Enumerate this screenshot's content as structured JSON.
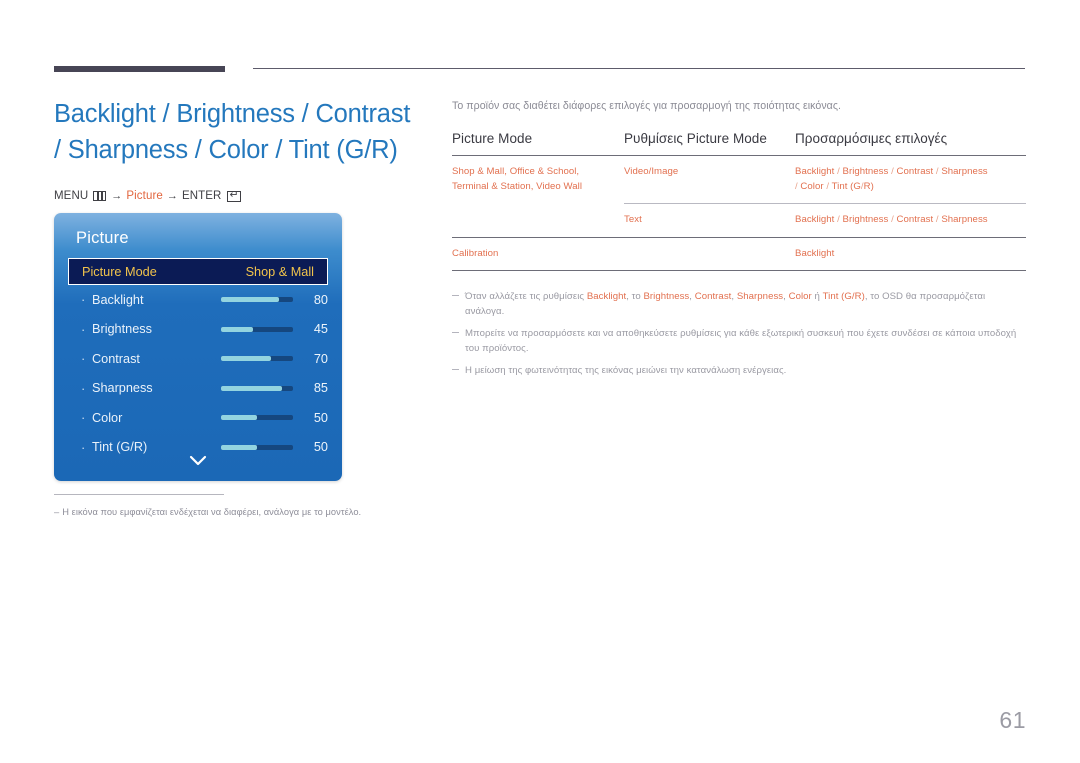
{
  "page": {
    "number": "61",
    "title": "Backlight / Brightness / Contrast\n/ Sharpness / Color / Tint (G/R)"
  },
  "menu_path": {
    "menu_label": "MENU",
    "menu_icon": "menu-grid-icon",
    "arrow1": "→",
    "target": "Picture",
    "arrow2": "→",
    "enter_label": "ENTER",
    "enter_icon": "enter-key-icon"
  },
  "osd": {
    "title": "Picture",
    "highlighted": {
      "label": "Picture Mode",
      "value": "Shop & Mall"
    },
    "items": [
      {
        "label": "Backlight",
        "value": "80",
        "percent": 80
      },
      {
        "label": "Brightness",
        "value": "45",
        "percent": 45
      },
      {
        "label": "Contrast",
        "value": "70",
        "percent": 70
      },
      {
        "label": "Sharpness",
        "value": "85",
        "percent": 85
      },
      {
        "label": "Color",
        "value": "50",
        "percent": 50
      },
      {
        "label": "Tint (G/R)",
        "value": "50",
        "percent": 50
      }
    ],
    "scroll_icon": "chevron-down-icon"
  },
  "left_note": "Η εικόνα που εμφανίζεται ενδέχεται να διαφέρει, ανάλογα με το μοντέλο.",
  "left_note_dash": "–",
  "intro": "Το προϊόν σας διαθέτει διάφορες επιλογές για προσαρμογή της ποιότητας εικόνας.",
  "table": {
    "headers": [
      "Picture Mode",
      "Ρυθμίσεις Picture Mode",
      "Προσαρμόσιμες επιλογές"
    ],
    "rows": [
      {
        "mode": "Shop & Mall, Office & School,\nTerminal & Station, Video Wall",
        "setting": "Video/Image",
        "options": "Backlight / Brightness / Contrast / Sharpness\n/ Color / Tint (G/R)"
      },
      {
        "mode": "",
        "setting": "Text",
        "options": "Backlight / Brightness / Contrast / Sharpness"
      },
      {
        "mode": "Calibration",
        "setting": "",
        "options": "Backlight"
      }
    ]
  },
  "notes": [
    {
      "parts": [
        {
          "t": "Όταν αλλάζετε τις ρυθμίσεις ",
          "hl": false
        },
        {
          "t": "Backlight",
          "hl": true
        },
        {
          "t": ", το ",
          "hl": false
        },
        {
          "t": "Brightness",
          "hl": true
        },
        {
          "t": ", ",
          "hl": false
        },
        {
          "t": "Contrast",
          "hl": true
        },
        {
          "t": ", ",
          "hl": false
        },
        {
          "t": "Sharpness",
          "hl": true
        },
        {
          "t": ", ",
          "hl": false
        },
        {
          "t": "Color",
          "hl": true
        },
        {
          "t": " ή ",
          "hl": false
        },
        {
          "t": "Tint (G/R)",
          "hl": true
        },
        {
          "t": ", το OSD θα προσαρμόζεται ανάλογα.",
          "hl": false
        }
      ]
    },
    {
      "parts": [
        {
          "t": "Μπορείτε να προσαρμόσετε και να αποθηκεύσετε ρυθμίσεις για κάθε εξωτερική συσκευή που έχετε συνδέσει σε κάποια υποδοχή του προϊόντος.",
          "hl": false
        }
      ]
    },
    {
      "parts": [
        {
          "t": "Η μείωση της φωτεινότητας της εικόνας μειώνει την κατανάλωση ενέργειας.",
          "hl": false
        }
      ]
    }
  ],
  "colors": {
    "title_blue": "#2478bd",
    "accent_orange": "#e2704f",
    "osd_blue": "#1f6dbb",
    "osd_highlight_bg": "#0b1b55",
    "osd_highlight_text": "#f1c34c",
    "slider_fill": "#93d4e0",
    "rule_dark": "#474555"
  }
}
